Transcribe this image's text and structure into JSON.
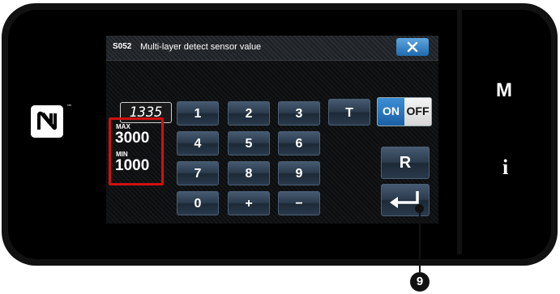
{
  "device": {
    "side_buttons": {
      "m_label": "M",
      "i_label": "i"
    },
    "nfc": {
      "icon": "nfc-icon",
      "trademark": "™"
    }
  },
  "dialog": {
    "code": "S052",
    "title": "Multi-layer detect sensor value",
    "close_icon": "close-icon",
    "close_color": "#1f6bb0"
  },
  "display": {
    "current_value": "1335",
    "max_label": "MAX",
    "max_value": "3000",
    "min_label": "MIN",
    "min_value": "1000",
    "limits_border_color": "#d01010"
  },
  "keypad": {
    "k1": "1",
    "k2": "2",
    "k3": "3",
    "k4": "4",
    "k5": "5",
    "k6": "6",
    "k7": "7",
    "k8": "8",
    "k9": "9",
    "k0": "0",
    "plus": "+",
    "minus": "−",
    "t_key": "T",
    "on_label": "ON",
    "off_label": "OFF",
    "reset": "R",
    "enter_icon": "enter-icon"
  },
  "callout": {
    "number": "9"
  }
}
